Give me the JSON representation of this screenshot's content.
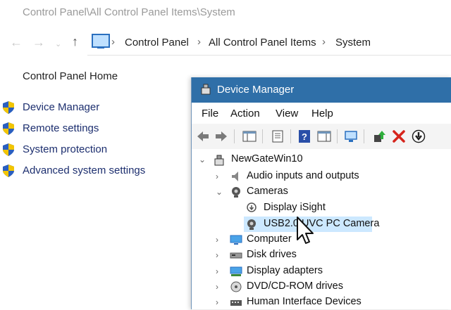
{
  "window": {
    "title": "Control Panel\\All Control Panel Items\\System"
  },
  "address_bar": {
    "breadcrumbs": [
      "Control Panel",
      "All Control Panel Items",
      "System"
    ]
  },
  "sidebar": {
    "home": "Control Panel Home",
    "links": [
      {
        "label": "Device Manager",
        "icon": "shield-icon"
      },
      {
        "label": "Remote settings",
        "icon": "shield-icon"
      },
      {
        "label": "System protection",
        "icon": "shield-icon"
      },
      {
        "label": "Advanced system settings",
        "icon": "shield-icon"
      }
    ]
  },
  "device_manager": {
    "title": "Device Manager",
    "menu": [
      "File",
      "Action",
      "View",
      "Help"
    ],
    "tree": {
      "root": "NewGateWin10",
      "items": [
        {
          "label": "Audio inputs and outputs",
          "expanded": false,
          "icon": "speaker-icon"
        },
        {
          "label": "Cameras",
          "expanded": true,
          "icon": "camera-icon",
          "children": [
            {
              "label": "Display iSight",
              "icon": "camera-download-icon"
            },
            {
              "label": "USB2.0 UVC PC Camera",
              "icon": "camera-icon",
              "selected": true
            }
          ]
        },
        {
          "label": "Computer",
          "expanded": false,
          "icon": "monitor-icon"
        },
        {
          "label": "Disk drives",
          "expanded": false,
          "icon": "disk-icon"
        },
        {
          "label": "Display adapters",
          "expanded": false,
          "icon": "display-adapter-icon"
        },
        {
          "label": "DVD/CD-ROM drives",
          "expanded": false,
          "icon": "dvd-icon"
        },
        {
          "label": "Human Interface Devices",
          "expanded": false,
          "icon": "hid-icon"
        }
      ]
    }
  },
  "colors": {
    "titlebar_blue": "#2f6fa8",
    "selection": "#cce8ff",
    "link": "#1d2f6f"
  }
}
